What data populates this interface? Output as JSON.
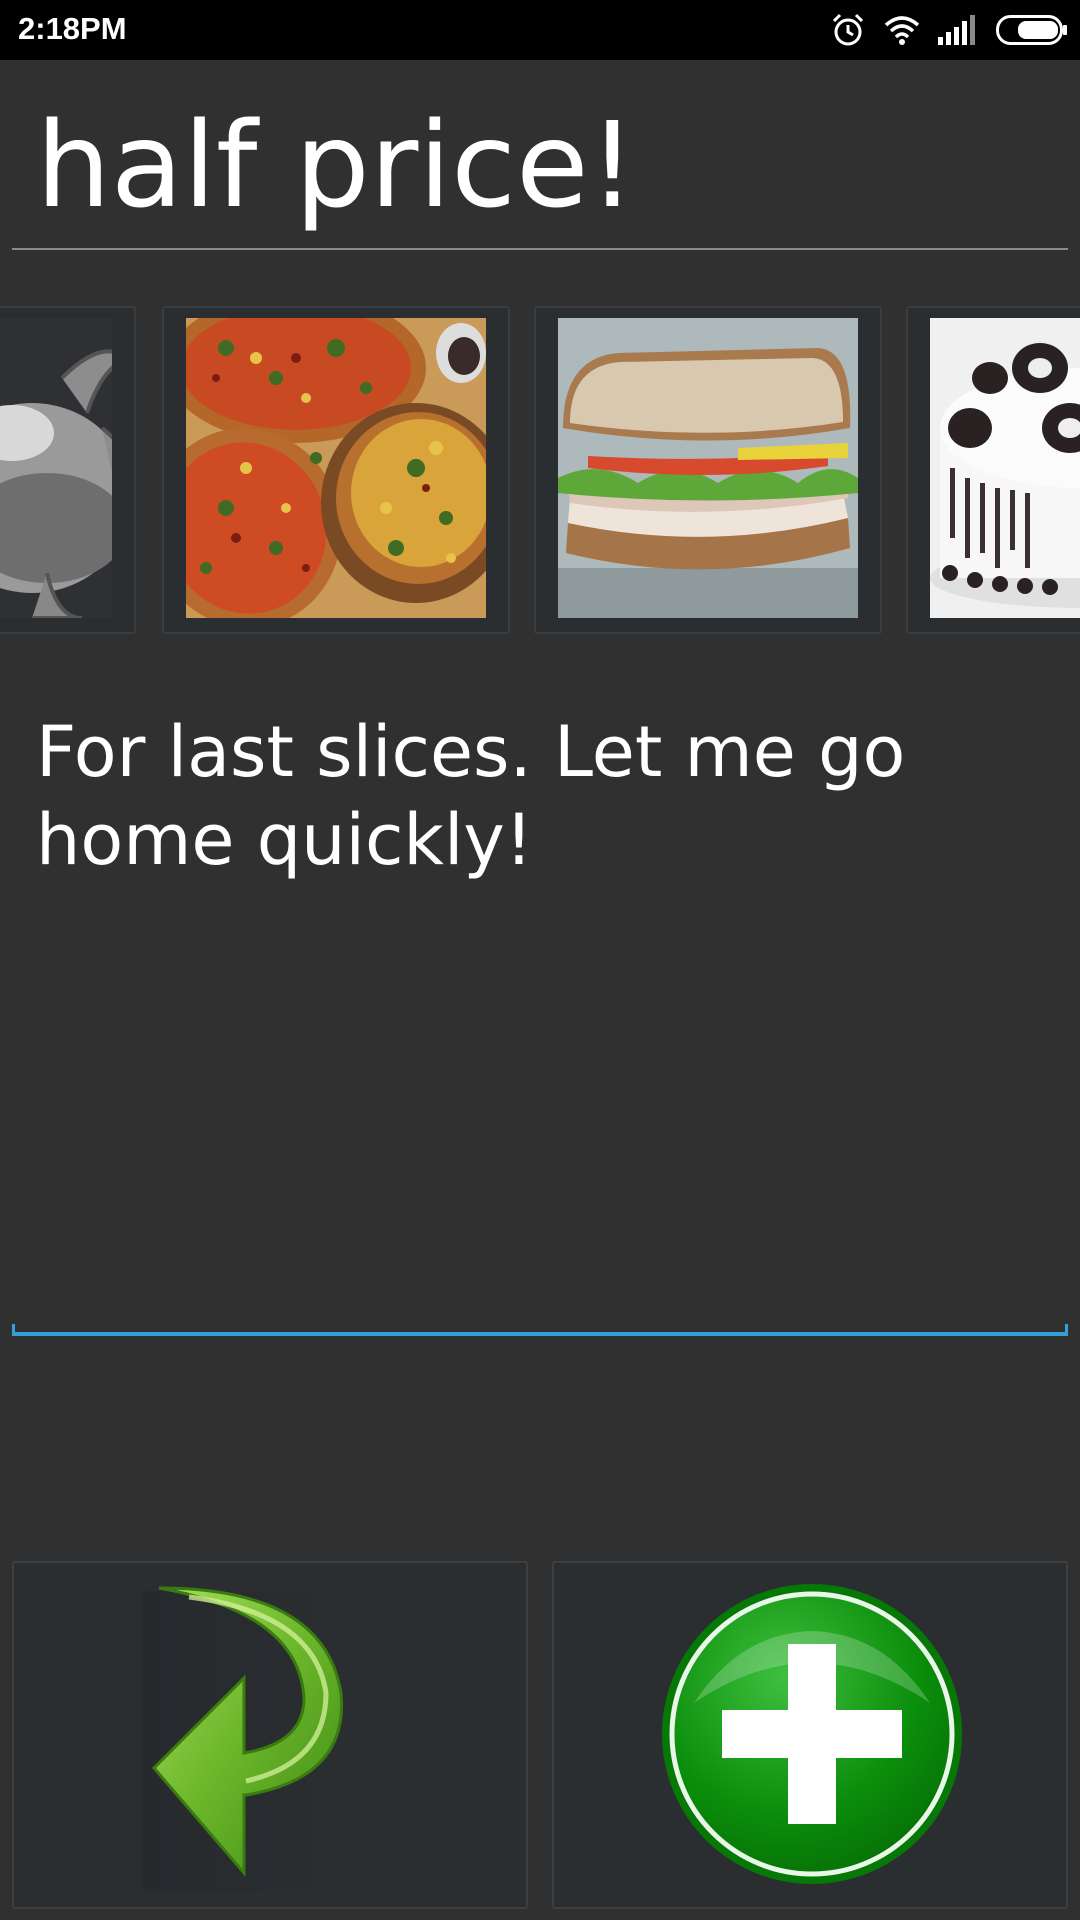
{
  "status_bar": {
    "time": "2:18PM",
    "icons": [
      "alarm-icon",
      "wifi-icon",
      "signal-icon",
      "battery-icon"
    ]
  },
  "title_field": {
    "value": "half price!"
  },
  "gallery": {
    "items": [
      {
        "name": "cartoon-character-image"
      },
      {
        "name": "pizza-image"
      },
      {
        "name": "sandwich-image"
      },
      {
        "name": "oreo-cake-image"
      }
    ]
  },
  "description_field": {
    "value": "For last slices. Let me go home quickly!",
    "accent_color": "#33a1d9"
  },
  "buttons": {
    "back_icon": "green-curved-arrow-icon",
    "add_icon": "green-plus-circle-icon"
  }
}
